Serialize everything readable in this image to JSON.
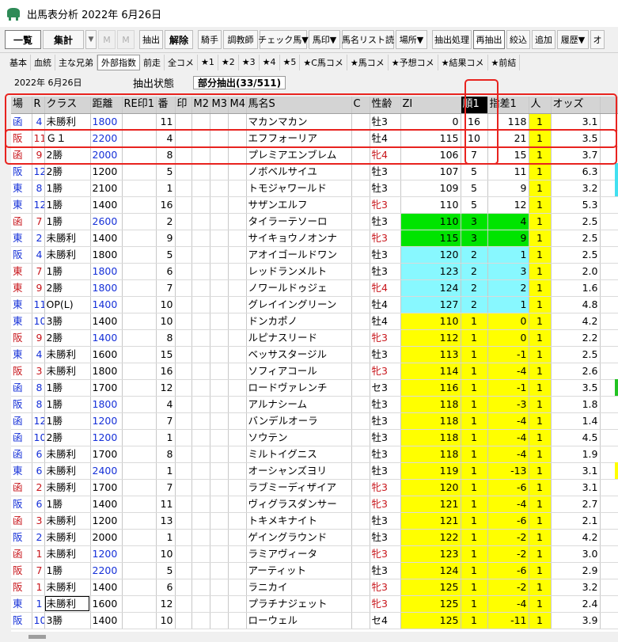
{
  "window": {
    "title": "出馬表分析 2022年 6月26日",
    "icon": "horse-icon"
  },
  "toolbar": [
    {
      "id": "ichiran",
      "label": "一覧",
      "bold": true,
      "active": true,
      "w": 46
    },
    {
      "id": "shukei",
      "label": "集計",
      "bold": true,
      "w": 52
    },
    {
      "id": "drop1",
      "label": "▼",
      "drop": true
    },
    {
      "id": "m1",
      "label": "M",
      "ghost": true,
      "w": 22
    },
    {
      "id": "m2",
      "label": "M",
      "ghost": true,
      "w": 22
    },
    {
      "id": "sep1",
      "sep": true
    },
    {
      "id": "chushutsu",
      "label": "抽出",
      "w": 30
    },
    {
      "id": "kaijo",
      "label": "解除",
      "bold": true,
      "w": 36
    },
    {
      "id": "sep2",
      "sep": true
    },
    {
      "id": "kishu",
      "label": "騎手",
      "w": 30
    },
    {
      "id": "chokyo",
      "label": "調教師",
      "w": 44
    },
    {
      "id": "check",
      "label": "チェック馬▼",
      "w": 60
    },
    {
      "id": "bashirushi",
      "label": "馬印▼",
      "w": 40
    },
    {
      "id": "bameilist",
      "label": "馬名リスト読",
      "w": 66
    },
    {
      "id": "basho",
      "label": "場所▼",
      "w": 40
    },
    {
      "id": "sep3",
      "sep": true
    },
    {
      "id": "chushutsushori",
      "label": "抽出処理",
      "w": 50
    },
    {
      "id": "saichushutsu",
      "label": "再抽出",
      "w": 40,
      "active": true
    },
    {
      "id": "shiborikomi",
      "label": "絞込",
      "w": 30
    },
    {
      "id": "tsuika",
      "label": "追加",
      "w": 30
    },
    {
      "id": "rireki",
      "label": "履歴▼",
      "w": 40
    },
    {
      "id": "more",
      "label": "オ",
      "w": 18
    }
  ],
  "tabs": [
    {
      "label": "基本"
    },
    {
      "label": "血統"
    },
    {
      "label": "主な兄弟"
    },
    {
      "label": "外部指数",
      "selected": true
    },
    {
      "label": "前走"
    },
    {
      "label": "全コメ"
    },
    {
      "label": "★1"
    },
    {
      "label": "★2"
    },
    {
      "label": "★3"
    },
    {
      "label": "★4"
    },
    {
      "label": "★5"
    },
    {
      "label": "★C馬コメ"
    },
    {
      "label": "★馬コメ"
    },
    {
      "label": "★予想コメ"
    },
    {
      "label": "★結果コメ"
    },
    {
      "label": "★前結"
    }
  ],
  "status": {
    "date": "2022年 6月26日",
    "state_label": "抽出状態",
    "state_value": "部分抽出(33/511)"
  },
  "columns": [
    {
      "key": "ba",
      "label": "場",
      "w": 26
    },
    {
      "key": "r",
      "label": "R",
      "w": 16
    },
    {
      "key": "class",
      "label": "クラス",
      "w": 58
    },
    {
      "key": "kyori",
      "label": "距離",
      "w": 40
    },
    {
      "key": "rei",
      "label": "RE印1",
      "w": 43
    },
    {
      "key": "ban",
      "label": "番",
      "w": 24
    },
    {
      "key": "in",
      "label": "印",
      "w": 21
    },
    {
      "key": "m2",
      "label": "M2",
      "w": 23
    },
    {
      "key": "m3",
      "label": "M3",
      "w": 23
    },
    {
      "key": "m4",
      "label": "M4",
      "w": 23
    },
    {
      "key": "name",
      "label": "馬名S",
      "w": 133
    },
    {
      "key": "c",
      "label": "C",
      "w": 23
    },
    {
      "key": "seirei",
      "label": "性齢",
      "w": 39
    },
    {
      "key": "zi",
      "label": "ZI",
      "w": 76
    },
    {
      "key": "jun",
      "label": "順1",
      "w": 34,
      "sorted": true
    },
    {
      "key": "shisa",
      "label": "指差1",
      "w": 52
    },
    {
      "key": "nin",
      "label": "人",
      "w": 28
    },
    {
      "key": "odds",
      "label": "オッズ",
      "w": 62
    },
    {
      "key": "extra",
      "label": "",
      "w": 58
    }
  ],
  "rows": [
    {
      "ba": "函",
      "r": "4",
      "bac": "blue",
      "class": "未勝利",
      "kyori": "1800",
      "kc": "blue",
      "ban": "11",
      "name": "マカンマカン",
      "seirei": "牡3",
      "sc": "",
      "zi": "0",
      "zbg": "",
      "jun": "16",
      "shisa": "118",
      "sbg": "",
      "nin": "1",
      "odds": "3.1",
      "edge": ""
    },
    {
      "ba": "阪",
      "r": "11",
      "bac": "red",
      "class": "Ｇ１",
      "kyori": "2200",
      "kc": "blue",
      "ban": "4",
      "name": "エフフォーリア",
      "seirei": "牡4",
      "sc": "",
      "zi": "115",
      "zbg": "",
      "jun": "10",
      "shisa": "21",
      "sbg": "",
      "nin": "1",
      "odds": "3.5",
      "edge": ""
    },
    {
      "ba": "函",
      "r": "9",
      "bac": "red",
      "class": "2勝",
      "kyori": "2000",
      "kc": "blue",
      "ban": "8",
      "name": "プレミアエンブレム",
      "seirei": "牝4",
      "sc": "red",
      "zi": "106",
      "zbg": "",
      "jun": "7",
      "shisa": "15",
      "sbg": "",
      "nin": "1",
      "odds": "3.7",
      "edge": ""
    },
    {
      "ba": "阪",
      "r": "12",
      "bac": "blue",
      "class": "2勝",
      "kyori": "1200",
      "kc": "",
      "ban": "5",
      "name": "ノボベルサイユ",
      "seirei": "牡3",
      "sc": "",
      "zi": "107",
      "zbg": "",
      "jun": "5",
      "shisa": "11",
      "sbg": "",
      "nin": "1",
      "odds": "6.3",
      "edge": "cyan"
    },
    {
      "ba": "東",
      "r": "8",
      "bac": "blue",
      "class": "1勝",
      "kyori": "2100",
      "kc": "",
      "ban": "1",
      "name": "トモジャワールド",
      "seirei": "牡3",
      "sc": "",
      "zi": "109",
      "zbg": "",
      "jun": "5",
      "shisa": "9",
      "sbg": "",
      "nin": "1",
      "odds": "3.2",
      "edge": "cyan"
    },
    {
      "ba": "東",
      "r": "12",
      "bac": "blue",
      "class": "1勝",
      "kyori": "1400",
      "kc": "",
      "ban": "16",
      "name": "サザンエルフ",
      "seirei": "牝3",
      "sc": "red",
      "zi": "110",
      "zbg": "",
      "jun": "5",
      "shisa": "12",
      "sbg": "",
      "nin": "1",
      "odds": "5.3",
      "edge": ""
    },
    {
      "ba": "函",
      "r": "7",
      "bac": "red",
      "class": "1勝",
      "kyori": "2600",
      "kc": "blue",
      "ban": "2",
      "name": "タイラーテソーロ",
      "seirei": "牡3",
      "sc": "",
      "zi": "110",
      "zbg": "green",
      "jun": "3",
      "shisa": "4",
      "sbg": "green",
      "nin": "1",
      "odds": "2.5",
      "edge": ""
    },
    {
      "ba": "東",
      "r": "2",
      "bac": "blue",
      "class": "未勝利",
      "kyori": "1400",
      "kc": "",
      "ban": "9",
      "name": "サイキョウノオンナ",
      "seirei": "牝3",
      "sc": "red",
      "zi": "115",
      "zbg": "green",
      "jun": "3",
      "shisa": "9",
      "sbg": "green",
      "nin": "1",
      "odds": "2.5",
      "edge": ""
    },
    {
      "ba": "阪",
      "r": "4",
      "bac": "blue",
      "class": "未勝利",
      "kyori": "1800",
      "kc": "",
      "ban": "5",
      "name": "アオイゴールドワン",
      "seirei": "牡3",
      "sc": "",
      "zi": "120",
      "zbg": "cyan",
      "jun": "2",
      "shisa": "1",
      "sbg": "cyan",
      "nin": "1",
      "odds": "2.5",
      "edge": ""
    },
    {
      "ba": "東",
      "r": "7",
      "bac": "red",
      "class": "1勝",
      "kyori": "1800",
      "kc": "blue",
      "ban": "6",
      "name": "レッドランメルト",
      "seirei": "牡3",
      "sc": "",
      "zi": "123",
      "zbg": "cyan",
      "jun": "2",
      "shisa": "3",
      "sbg": "cyan",
      "nin": "1",
      "odds": "2.0",
      "edge": ""
    },
    {
      "ba": "東",
      "r": "9",
      "bac": "red",
      "class": "2勝",
      "kyori": "1800",
      "kc": "blue",
      "ban": "7",
      "name": "ノワールドゥジェ",
      "seirei": "牝4",
      "sc": "red",
      "zi": "124",
      "zbg": "cyan",
      "jun": "2",
      "shisa": "2",
      "sbg": "cyan",
      "nin": "1",
      "odds": "1.6",
      "edge": ""
    },
    {
      "ba": "東",
      "r": "11",
      "bac": "blue",
      "class": "OP(L)",
      "kyori": "1400",
      "kc": "blue",
      "ban": "10",
      "name": "グレイイングリーン",
      "seirei": "牡4",
      "sc": "",
      "zi": "127",
      "zbg": "cyan",
      "jun": "2",
      "shisa": "1",
      "sbg": "cyan",
      "nin": "1",
      "odds": "4.8",
      "edge": ""
    },
    {
      "ba": "東",
      "r": "10",
      "bac": "blue",
      "class": "3勝",
      "kyori": "1400",
      "kc": "",
      "ban": "10",
      "name": "ドンカポノ",
      "seirei": "牡4",
      "sc": "",
      "zi": "110",
      "zbg": "yellow",
      "jun": "1",
      "shisa": "0",
      "sbg": "yellow",
      "nin": "1",
      "odds": "4.2",
      "edge": ""
    },
    {
      "ba": "阪",
      "r": "9",
      "bac": "red",
      "class": "2勝",
      "kyori": "1400",
      "kc": "blue",
      "ban": "8",
      "name": "ルピナスリード",
      "seirei": "牝3",
      "sc": "red",
      "zi": "112",
      "zbg": "yellow",
      "jun": "1",
      "shisa": "0",
      "sbg": "yellow",
      "nin": "1",
      "odds": "2.2",
      "edge": ""
    },
    {
      "ba": "東",
      "r": "4",
      "bac": "blue",
      "class": "未勝利",
      "kyori": "1600",
      "kc": "",
      "ban": "15",
      "name": "ベッサスタージル",
      "seirei": "牡3",
      "sc": "",
      "zi": "113",
      "zbg": "yellow",
      "jun": "1",
      "shisa": "-1",
      "sbg": "yellow",
      "nin": "1",
      "odds": "2.5",
      "edge": ""
    },
    {
      "ba": "阪",
      "r": "3",
      "bac": "red",
      "class": "未勝利",
      "kyori": "1800",
      "kc": "",
      "ban": "16",
      "name": "ソフィアコール",
      "seirei": "牝3",
      "sc": "red",
      "zi": "114",
      "zbg": "yellow",
      "jun": "1",
      "shisa": "-4",
      "sbg": "yellow",
      "nin": "1",
      "odds": "2.6",
      "edge": ""
    },
    {
      "ba": "函",
      "r": "8",
      "bac": "blue",
      "class": "1勝",
      "kyori": "1700",
      "kc": "",
      "ban": "12",
      "name": "ロードヴァレンチ",
      "seirei": "セ3",
      "sc": "",
      "zi": "116",
      "zbg": "yellow",
      "jun": "1",
      "shisa": "-1",
      "sbg": "yellow",
      "nin": "1",
      "odds": "3.5",
      "edge": "green"
    },
    {
      "ba": "阪",
      "r": "8",
      "bac": "blue",
      "class": "1勝",
      "kyori": "1800",
      "kc": "blue",
      "ban": "4",
      "name": "アルナシーム",
      "seirei": "牡3",
      "sc": "",
      "zi": "118",
      "zbg": "yellow",
      "jun": "1",
      "shisa": "-3",
      "sbg": "yellow",
      "nin": "1",
      "odds": "1.8",
      "edge": ""
    },
    {
      "ba": "函",
      "r": "12",
      "bac": "blue",
      "class": "1勝",
      "kyori": "1200",
      "kc": "blue",
      "ban": "7",
      "name": "バンデルオーラ",
      "seirei": "牡3",
      "sc": "",
      "zi": "118",
      "zbg": "yellow",
      "jun": "1",
      "shisa": "-4",
      "sbg": "yellow",
      "nin": "1",
      "odds": "1.4",
      "edge": ""
    },
    {
      "ba": "函",
      "r": "10",
      "bac": "blue",
      "class": "2勝",
      "kyori": "1200",
      "kc": "blue",
      "ban": "1",
      "name": "ソウテン",
      "seirei": "牡3",
      "sc": "",
      "zi": "118",
      "zbg": "yellow",
      "jun": "1",
      "shisa": "-4",
      "sbg": "yellow",
      "nin": "1",
      "odds": "4.5",
      "edge": ""
    },
    {
      "ba": "函",
      "r": "6",
      "bac": "blue",
      "class": "未勝利",
      "kyori": "1700",
      "kc": "",
      "ban": "8",
      "name": "ミルトイグニス",
      "seirei": "牡3",
      "sc": "",
      "zi": "118",
      "zbg": "yellow",
      "jun": "1",
      "shisa": "-4",
      "sbg": "yellow",
      "nin": "1",
      "odds": "1.9",
      "edge": ""
    },
    {
      "ba": "東",
      "r": "6",
      "bac": "blue",
      "class": "未勝利",
      "kyori": "2400",
      "kc": "blue",
      "ban": "1",
      "name": "オーシャンズヨリ",
      "seirei": "牡3",
      "sc": "",
      "zi": "119",
      "zbg": "yellow",
      "jun": "1",
      "shisa": "-13",
      "sbg": "yellow",
      "nin": "1",
      "odds": "3.1",
      "edge": "yellow"
    },
    {
      "ba": "函",
      "r": "2",
      "bac": "red",
      "class": "未勝利",
      "kyori": "1700",
      "kc": "",
      "ban": "7",
      "name": "ラブミーディザイア",
      "seirei": "牝3",
      "sc": "red",
      "zi": "120",
      "zbg": "yellow",
      "jun": "1",
      "shisa": "-6",
      "sbg": "yellow",
      "nin": "1",
      "odds": "3.1",
      "edge": ""
    },
    {
      "ba": "阪",
      "r": "6",
      "bac": "blue",
      "class": "1勝",
      "kyori": "1400",
      "kc": "",
      "ban": "11",
      "name": "ヴィグラスダンサー",
      "seirei": "牝3",
      "sc": "red",
      "zi": "121",
      "zbg": "yellow",
      "jun": "1",
      "shisa": "-4",
      "sbg": "yellow",
      "nin": "1",
      "odds": "2.7",
      "edge": ""
    },
    {
      "ba": "函",
      "r": "3",
      "bac": "red",
      "class": "未勝利",
      "kyori": "1200",
      "kc": "",
      "ban": "13",
      "name": "トキメキナイト",
      "seirei": "牡3",
      "sc": "",
      "zi": "121",
      "zbg": "yellow",
      "jun": "1",
      "shisa": "-6",
      "sbg": "yellow",
      "nin": "1",
      "odds": "2.1",
      "edge": ""
    },
    {
      "ba": "阪",
      "r": "2",
      "bac": "blue",
      "class": "未勝利",
      "kyori": "2000",
      "kc": "",
      "ban": "1",
      "name": "ゲイングラウンド",
      "seirei": "牡3",
      "sc": "",
      "zi": "122",
      "zbg": "yellow",
      "jun": "1",
      "shisa": "-2",
      "sbg": "yellow",
      "nin": "1",
      "odds": "4.2",
      "edge": ""
    },
    {
      "ba": "函",
      "r": "1",
      "bac": "red",
      "class": "未勝利",
      "kyori": "1200",
      "kc": "blue",
      "ban": "10",
      "name": "ラミアヴィータ",
      "seirei": "牝3",
      "sc": "red",
      "zi": "123",
      "zbg": "yellow",
      "jun": "1",
      "shisa": "-2",
      "sbg": "yellow",
      "nin": "1",
      "odds": "3.0",
      "edge": ""
    },
    {
      "ba": "阪",
      "r": "7",
      "bac": "red",
      "class": "1勝",
      "kyori": "2200",
      "kc": "blue",
      "ban": "5",
      "name": "アーティット",
      "seirei": "牡3",
      "sc": "",
      "zi": "124",
      "zbg": "yellow",
      "jun": "1",
      "shisa": "-6",
      "sbg": "yellow",
      "nin": "1",
      "odds": "2.9",
      "edge": ""
    },
    {
      "ba": "阪",
      "r": "1",
      "bac": "red",
      "class": "未勝利",
      "kyori": "1400",
      "kc": "",
      "ban": "6",
      "name": "ラニカイ",
      "seirei": "牝3",
      "sc": "red",
      "zi": "125",
      "zbg": "yellow",
      "jun": "1",
      "shisa": "-2",
      "sbg": "yellow",
      "nin": "1",
      "odds": "3.2",
      "edge": ""
    },
    {
      "ba": "東",
      "r": "1",
      "bac": "blue",
      "class": "未勝利",
      "classBox": true,
      "kyori": "1600",
      "kc": "",
      "ban": "12",
      "name": "プラチナジェット",
      "seirei": "牝3",
      "sc": "red",
      "zi": "125",
      "zbg": "yellow",
      "jun": "1",
      "shisa": "-4",
      "sbg": "yellow",
      "nin": "1",
      "odds": "2.4",
      "edge": ""
    },
    {
      "ba": "阪",
      "r": "10",
      "bac": "blue",
      "class": "3勝",
      "kyori": "1400",
      "kc": "",
      "ban": "10",
      "name": "ローウェル",
      "seirei": "セ4",
      "sc": "",
      "zi": "125",
      "zbg": "yellow",
      "jun": "1",
      "shisa": "-11",
      "sbg": "yellow",
      "nin": "1",
      "odds": "3.9",
      "edge": ""
    }
  ],
  "highlight_color": "#e8231f"
}
